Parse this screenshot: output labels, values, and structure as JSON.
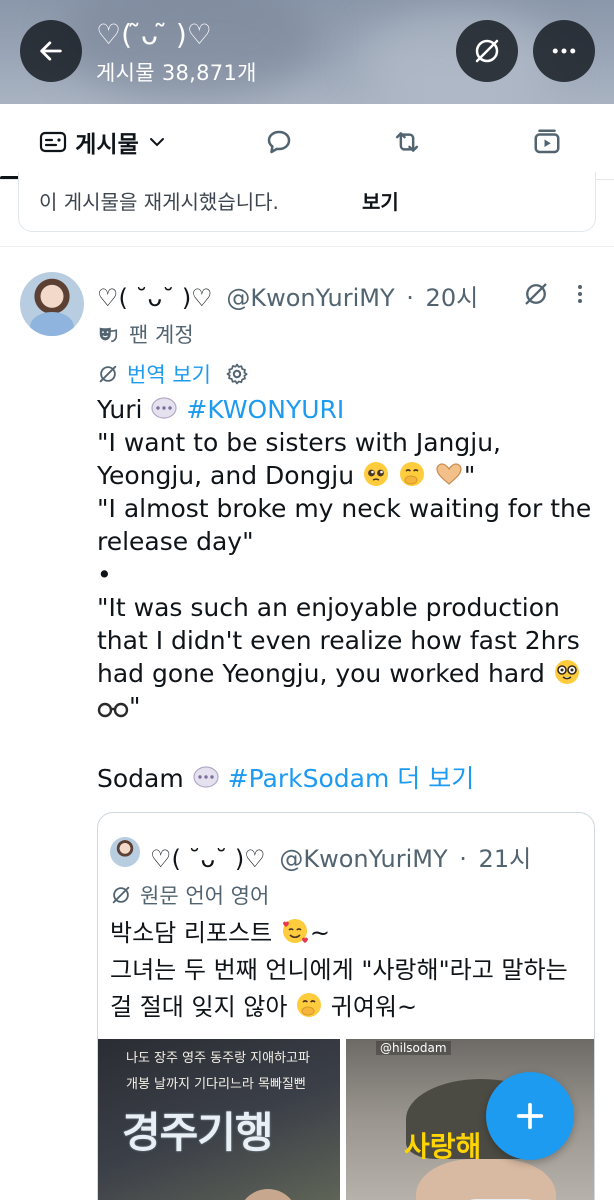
{
  "header": {
    "title": "♡(  ̃ᴗ ̃ )♡",
    "post_count": "게시물 38,871개"
  },
  "tabs": [
    {
      "label": "게시물",
      "selected": true
    },
    {
      "label": "replies",
      "icon": "speech-bubble-icon"
    },
    {
      "label": "reposts",
      "icon": "repost-icon"
    },
    {
      "label": "media",
      "icon": "media-icon"
    }
  ],
  "notice": {
    "text": "이 게시물을 재게시했습니다.",
    "link": "보기"
  },
  "tweet": {
    "author_name": "♡( ˘ᴗ˘ )♡",
    "handle": "@KwonYuriMY",
    "separator": "·",
    "time": "20시",
    "fan_label": "팬 계정",
    "translate_label": "번역 보기",
    "lines": {
      "l1_prefix": "Yuri",
      "l1_hashtag": "#KWONYURI",
      "l2": "\"I want to be sisters with Jangju,",
      "l3_text": "Yeongju, and Dongju",
      "l3_end": "\"",
      "l4": "\"I almost broke my neck waiting for the",
      "l5": "release day\"",
      "l6": "•",
      "l7": "\"It was such an enjoyable production",
      "l8": "that I didn't even realize how fast 2hrs",
      "l9": "had gone   Yeongju, you worked hard",
      "l10_end": "\"",
      "l11_prefix": "Sodam",
      "l11_hashtag": "#ParkSodam",
      "l11_more": "더 보기"
    }
  },
  "quote": {
    "author_name": "♡( ˘ᴗ˘ )♡",
    "handle": "@KwonYuriMY",
    "separator": "·",
    "time": "21시",
    "lang_label": "원문 언어 영어",
    "line1": "박소담 리포스트",
    "line1_end": "~",
    "line2": "그녀는 두 번째 언니에게 \"사랑해\"라고 말하는",
    "line3_prefix": "걸 절대 잊지 않아",
    "line3_end": "귀여워~",
    "image1": {
      "poster_lines": [
        "나도  장주  영주  동주랑  지애하고파",
        "개봉  날까지  기다리느라  목빠질뻔"
      ],
      "poster_title": "경주기행"
    },
    "image2": {
      "handle_tag": "@hilsodam",
      "cap_text": "사랑해"
    }
  },
  "fab": {
    "label": "+"
  },
  "colors": {
    "accent": "#1d9bf0",
    "text": "#0f1419",
    "muted": "#536471",
    "header_bg": "#96a2b3"
  }
}
